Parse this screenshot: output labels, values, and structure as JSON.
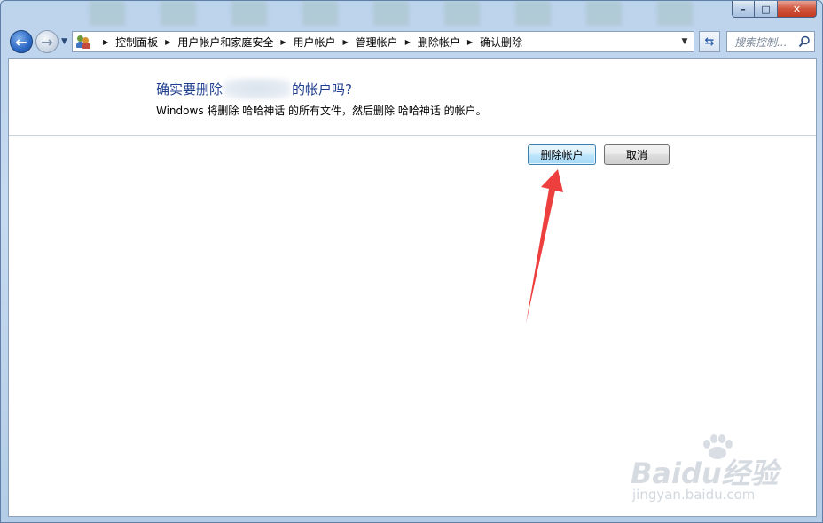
{
  "breadcrumb": [
    "控制面板",
    "用户帐户和家庭安全",
    "用户帐户",
    "管理帐户",
    "删除帐户",
    "确认删除"
  ],
  "search": {
    "placeholder": "搜索控制..."
  },
  "dialog": {
    "title_prefix": "确实要删除",
    "title_suffix": "的帐户吗?",
    "description": "Windows 将删除 哈哈神话 的所有文件，然后删除 哈哈神话 的帐户。"
  },
  "buttons": {
    "delete": "删除帐户",
    "cancel": "取消"
  },
  "caption": {
    "minimize": "–",
    "maximize": "□",
    "close": "✕"
  },
  "watermark": {
    "brand": "Baidu经验",
    "url": "jingyan.baidu.com"
  },
  "colors": {
    "title": "#1e3d8f",
    "arrow": "#ee3f3f",
    "primary_border": "#3c7fb1"
  },
  "icons": [
    "back-icon",
    "forward-icon",
    "recent-pages-icon",
    "users-icon",
    "refresh-icon",
    "search-icon",
    "pointer-arrow"
  ]
}
